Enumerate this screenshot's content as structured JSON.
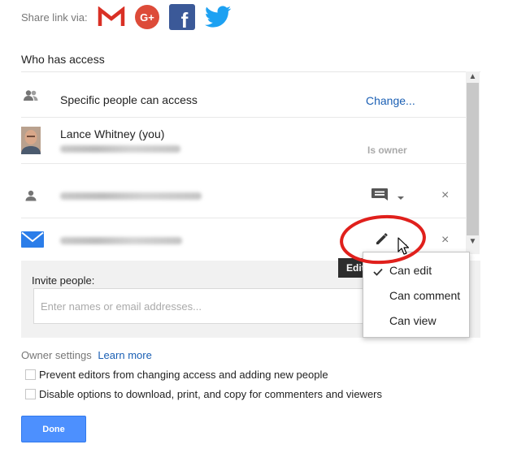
{
  "share": {
    "label": "Share link via:",
    "services": [
      {
        "name": "gmail-icon",
        "color": "#d93025"
      },
      {
        "name": "google-plus-icon",
        "color": "#dd4b39",
        "text": "G+"
      },
      {
        "name": "facebook-icon",
        "color": "#3b5998",
        "text": "f"
      },
      {
        "name": "twitter-icon",
        "color": "#1da1f2"
      }
    ]
  },
  "access": {
    "title": "Who has access",
    "link_row": {
      "label": "Specific people can access",
      "action": "Change..."
    },
    "owner_row": {
      "name": "Lance Whitney (you)",
      "role": "Is owner"
    },
    "remove_symbol": "×"
  },
  "tooltip": {
    "text": "Edit"
  },
  "permission_menu": {
    "items": [
      {
        "label": "Can edit",
        "selected": true
      },
      {
        "label": "Can comment",
        "selected": false
      },
      {
        "label": "Can view",
        "selected": false
      }
    ]
  },
  "invite": {
    "label": "Invite people:",
    "placeholder": "Enter names or email addresses..."
  },
  "owner_settings": {
    "label": "Owner settings",
    "link": "Learn more",
    "options": [
      "Prevent editors from changing access and adding new people",
      "Disable options to download, print, and copy for commenters and viewers"
    ]
  },
  "done_button": "Done",
  "colors": {
    "accent": "#4d90fe",
    "link": "#1a5fb4",
    "highlight": "#e0201c",
    "mail_blue": "#2b7de9"
  }
}
